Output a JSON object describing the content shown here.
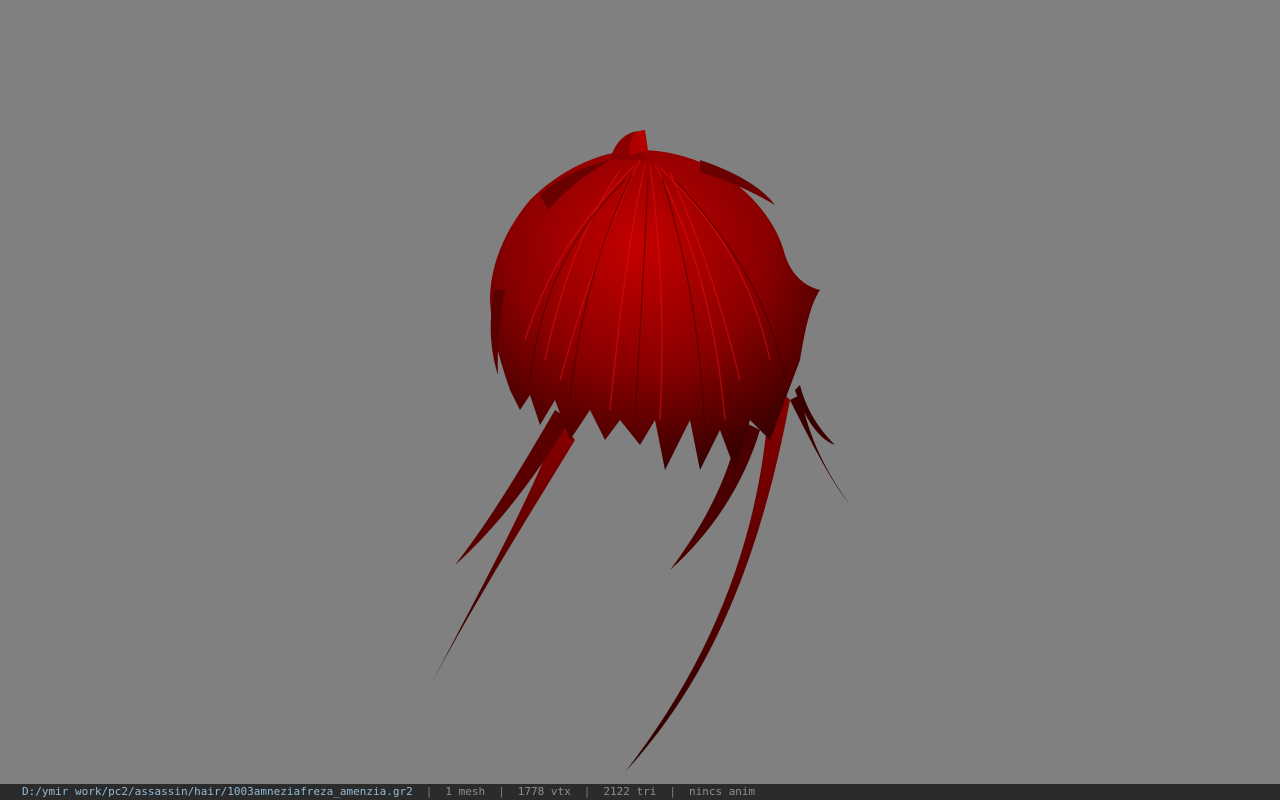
{
  "viewer": {
    "background_color": "#808080",
    "model": {
      "description_icon": "hair-model-icon",
      "color": "#b00000"
    }
  },
  "statusbar": {
    "file_path": "D:/ymir work/pc2/assassin/hair/1003amneziafreza_amenzia.gr2",
    "separator": "|",
    "mesh_count": "1 mesh",
    "vertex_count": "1778 vtx",
    "triangle_count": "2122 tri",
    "anim_status": "nincs anim"
  }
}
